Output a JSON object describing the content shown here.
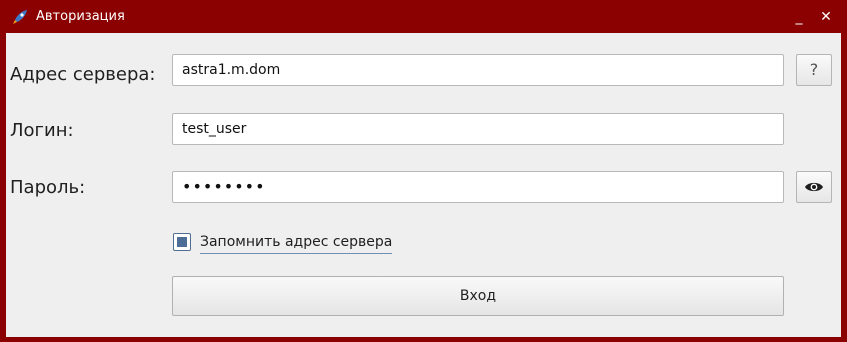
{
  "window": {
    "title": "Авторизация",
    "minimize_label": "_",
    "close_label": "✕"
  },
  "form": {
    "server_label": "Адрес сервера:",
    "server_value": "astra1.m.dom",
    "help_label": "?",
    "login_label": "Логин:",
    "login_value": "test_user",
    "password_label": "Пароль:",
    "password_value": "••••••••",
    "show_password_icon": "eye-icon",
    "remember_label": "Запомнить адрес сервера",
    "remember_checked": true,
    "submit_label": "Вход"
  },
  "colors": {
    "titlebar": "#8b0000",
    "client_background": "#efefef",
    "checkbox_accent": "#4d6e97"
  }
}
